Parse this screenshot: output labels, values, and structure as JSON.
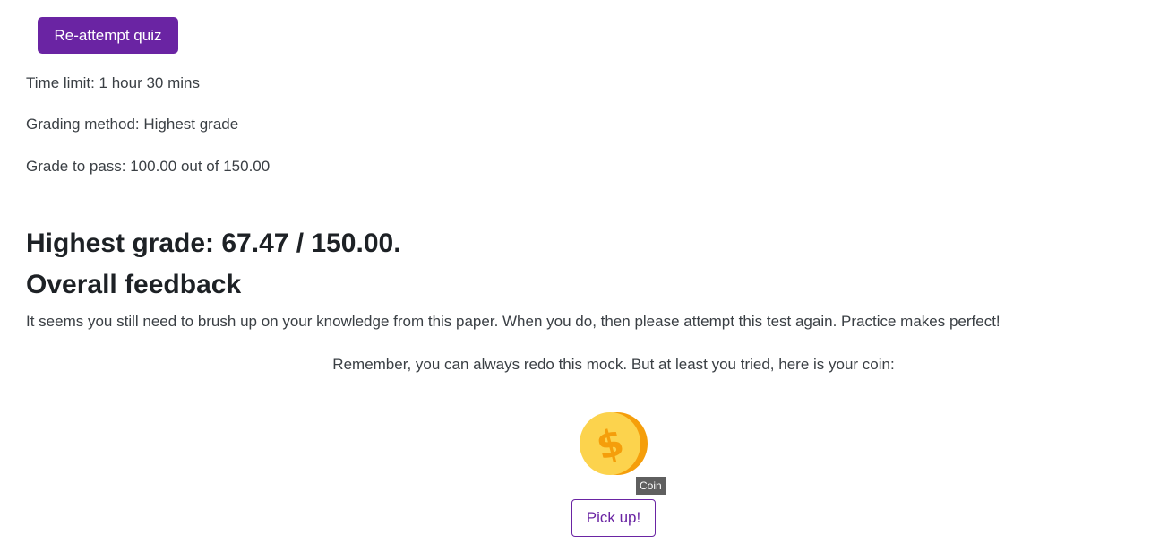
{
  "quiz": {
    "reattempt_label": "Re-attempt quiz",
    "time_limit": "Time limit: 1 hour 30 mins",
    "grading_method": "Grading method: Highest grade",
    "grade_to_pass": "Grade to pass: 100.00 out of 150.00"
  },
  "result": {
    "highest_grade": "Highest grade: 67.47 / 150.00.",
    "feedback_heading": "Overall feedback",
    "feedback_text": "It seems you still need to brush up on your knowledge from this paper. When you do, then please attempt this test again. Practice makes perfect!",
    "remember_text": "Remember, you can always redo this mock. But at least you tried, here is your coin:"
  },
  "coin": {
    "icon": "dollar-coin-icon",
    "tooltip": "Coin",
    "pickup_label": "Pick up!"
  },
  "colors": {
    "accent": "#6a24a3",
    "coin_front": "#fcd34d",
    "coin_back": "#f59e0b",
    "tooltip_bg": "#5f5f5f"
  }
}
